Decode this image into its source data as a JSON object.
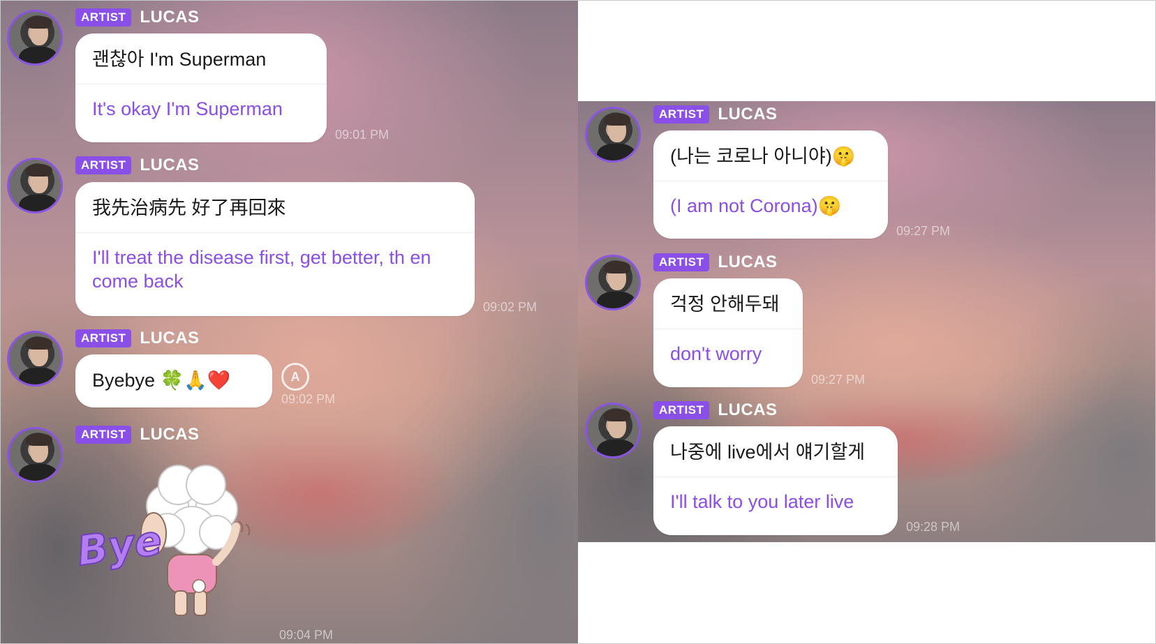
{
  "colors": {
    "accent": "#8b4fe8",
    "badge": "#8a4fe6",
    "bubble": "#ffffff"
  },
  "left_panel": {
    "messages": [
      {
        "badge": "ARTIST",
        "name": "LUCAS",
        "original": "괜찮아 I'm Superman",
        "translation": "It's okay I'm Superman",
        "time": "09:01 PM"
      },
      {
        "badge": "ARTIST",
        "name": "LUCAS",
        "original": "我先治病先 好了再回來",
        "translation": "I'll treat the disease first, get better, th en come back",
        "time": "09:02 PM"
      },
      {
        "badge": "ARTIST",
        "name": "LUCAS",
        "original": "Byebye 🍀🙏❤️",
        "time": "09:02 PM",
        "translate_icon": "translate-icon"
      },
      {
        "badge": "ARTIST",
        "name": "LUCAS",
        "sticker_text": "Bye",
        "time": "09:04 PM"
      }
    ]
  },
  "right_panel": {
    "messages": [
      {
        "badge": "ARTIST",
        "name": "LUCAS",
        "original": "(나는 코로나 아니야)🤫",
        "translation": "(I am not Corona)🤫",
        "time": "09:27 PM"
      },
      {
        "badge": "ARTIST",
        "name": "LUCAS",
        "original": "걱정 안해두돼",
        "translation": "don't worry",
        "time": "09:27 PM"
      },
      {
        "badge": "ARTIST",
        "name": "LUCAS",
        "original": "나중에 live에서  얘기할게",
        "translation": "I'll talk to you later live",
        "time": "09:28 PM"
      }
    ]
  }
}
